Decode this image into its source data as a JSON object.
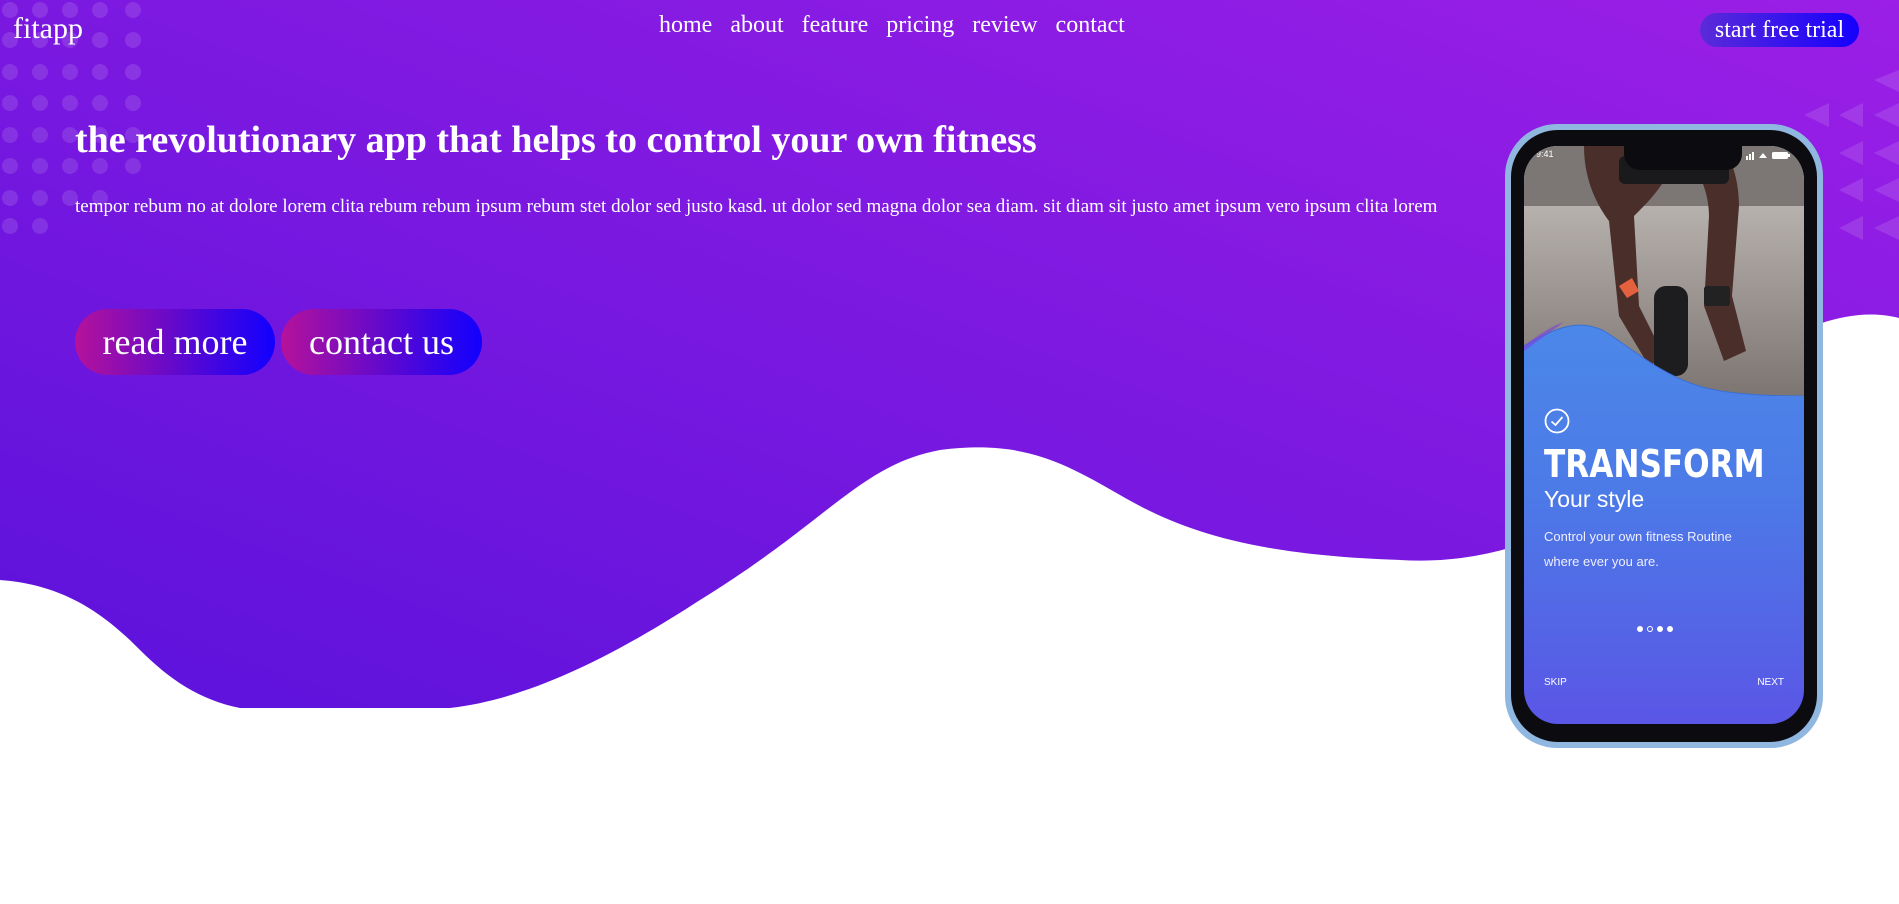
{
  "header": {
    "logo": "fitapp",
    "nav": [
      "home",
      "about",
      "feature",
      "pricing",
      "review",
      "contact"
    ],
    "trial_button": "start free trial"
  },
  "hero": {
    "headline": "the revolutionary app that helps to control your own fitness",
    "description": "tempor rebum no at dolore lorem clita rebum rebum ipsum rebum stet dolor sed justo kasd. ut dolor sed magna dolor sea diam. sit diam sit justo amet ipsum vero ipsum clita lorem",
    "buttons": {
      "read_more": "read more",
      "contact_us": "contact us"
    }
  },
  "phone": {
    "time": "9:41",
    "title": "TRANSFORM",
    "subtitle": "Your style",
    "description": "Control your own fitness Routine where ever you are.",
    "skip": "SKIP",
    "next": "NEXT"
  },
  "colors": {
    "hero_gradient_start": "#5b12db",
    "hero_gradient_end": "#9b1fe6",
    "button_gradient_start": "#b5129a",
    "button_gradient_end": "#1100ff"
  },
  "icons": [
    "check-circle-icon",
    "signal-icon",
    "wifi-icon",
    "battery-icon"
  ]
}
